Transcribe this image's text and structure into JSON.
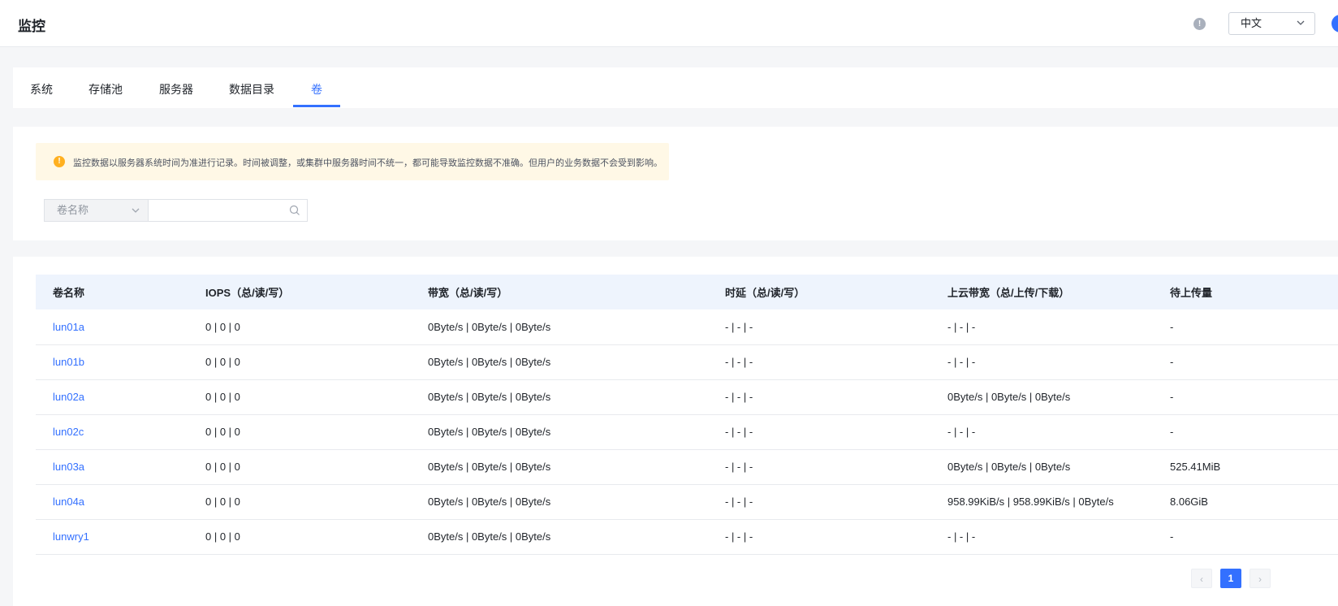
{
  "header": {
    "title": "监控",
    "help_icon_glyph": "!",
    "language": "中文"
  },
  "tabs": [
    {
      "label": "系统"
    },
    {
      "label": "存储池"
    },
    {
      "label": "服务器"
    },
    {
      "label": "数据目录"
    },
    {
      "label": "卷",
      "active": true
    }
  ],
  "notice": {
    "icon_glyph": "!",
    "text": "监控数据以服务器系统时间为准进行记录。时间被调整，或集群中服务器时间不统一，都可能导致监控数据不准确。但用户的业务数据不会受到影响。"
  },
  "filter": {
    "field_select": "卷名称",
    "search_value": "",
    "search_placeholder": ""
  },
  "table": {
    "columns": [
      "卷名称",
      "IOPS（总/读/写）",
      "带宽（总/读/写）",
      "时延（总/读/写）",
      "上云带宽（总/上传/下载）",
      "待上传量"
    ],
    "rows": [
      [
        "lun01a",
        "0 | 0 | 0",
        "0Byte/s | 0Byte/s | 0Byte/s",
        "- | - | -",
        "- | - | -",
        "-"
      ],
      [
        "lun01b",
        "0 | 0 | 0",
        "0Byte/s | 0Byte/s | 0Byte/s",
        "- | - | -",
        "- | - | -",
        "-"
      ],
      [
        "lun02a",
        "0 | 0 | 0",
        "0Byte/s | 0Byte/s | 0Byte/s",
        "- | - | -",
        "0Byte/s | 0Byte/s | 0Byte/s",
        "-"
      ],
      [
        "lun02c",
        "0 | 0 | 0",
        "0Byte/s | 0Byte/s | 0Byte/s",
        "- | - | -",
        "- | - | -",
        "-"
      ],
      [
        "lun03a",
        "0 | 0 | 0",
        "0Byte/s | 0Byte/s | 0Byte/s",
        "- | - | -",
        "0Byte/s | 0Byte/s | 0Byte/s",
        "525.41MiB"
      ],
      [
        "lun04a",
        "0 | 0 | 0",
        "0Byte/s | 0Byte/s | 0Byte/s",
        "- | - | -",
        "958.99KiB/s | 958.99KiB/s | 0Byte/s",
        "8.06GiB"
      ],
      [
        "lunwry1",
        "0 | 0 | 0",
        "0Byte/s | 0Byte/s | 0Byte/s",
        "- | - | -",
        "- | - | -",
        "-"
      ]
    ]
  },
  "pagination": {
    "prev_glyph": "‹",
    "current_page": "1",
    "next_glyph": "›"
  },
  "colors": {
    "accent": "#3370ff",
    "notice_bg": "#fff8e6",
    "notice_icon": "#ffb020",
    "table_header_bg": "#eef4fd"
  }
}
